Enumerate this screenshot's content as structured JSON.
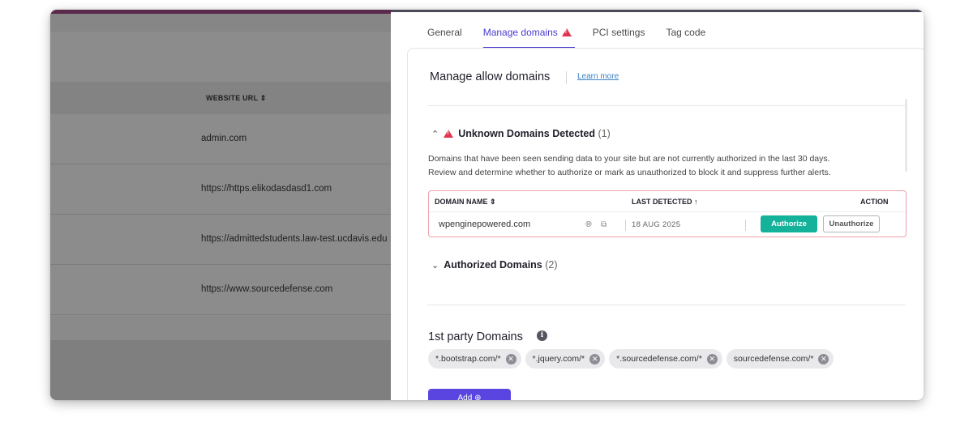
{
  "background_table": {
    "column_header": "WEBSITE URL",
    "sort_icon": "sort-arrows-icon",
    "rows": [
      "admin.com",
      "https://https.elikodasdasd1.com",
      "https://admittedstudents.law-test.ucdavis.edu",
      "https://www.sourcedefense.com"
    ]
  },
  "tabs": [
    {
      "label": "General",
      "active": false
    },
    {
      "label": "Manage domains",
      "active": true,
      "warning_icon": "warning-triangle-icon"
    },
    {
      "label": "PCI settings",
      "active": false
    },
    {
      "label": "Tag code",
      "active": false
    }
  ],
  "manage": {
    "title": "Manage allow domains",
    "learn_more": "Learn more"
  },
  "unknown": {
    "title": "Unknown Domains Detected",
    "count": "(1)",
    "description_line1": "Domains that have been seen sending data to your site but are not currently authorized in the last 30 days.",
    "description_line2": "Review and determine whether to authorize or mark as unauthorized to block it and suppress further alerts.",
    "columns": {
      "domain_name": "DOMAIN NAME",
      "last_detected": "LAST DETECTED",
      "action": "ACTION"
    },
    "rows": [
      {
        "domain": "wpenginepowered.com",
        "last_detected": "18 AUG 2025",
        "authorize": "Authorize",
        "unauthorize": "Unauthorize"
      }
    ]
  },
  "authorized": {
    "title": "Authorized Domains",
    "count": "(2)"
  },
  "first_party": {
    "title": "1st party Domains",
    "chips": [
      "*.bootstrap.com/*",
      "*.jquery.com/*",
      "*.sourcedefense.com/*",
      "sourcedefense.com/*"
    ],
    "add_label": "Add"
  },
  "colors": {
    "accent": "#4b3cd1",
    "authorize": "#14b29a",
    "warning": "#e0344f"
  }
}
